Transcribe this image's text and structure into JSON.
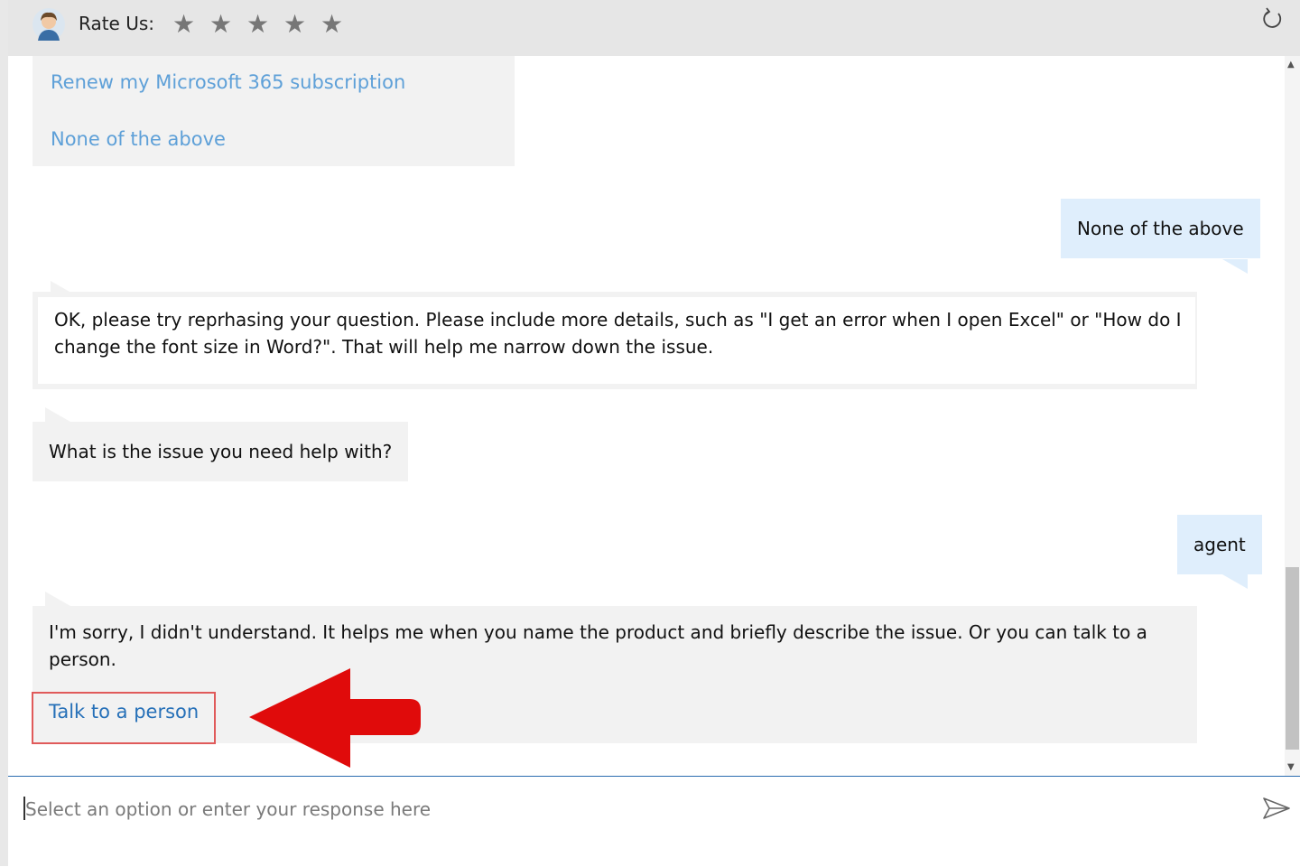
{
  "header": {
    "rate_label": "Rate Us:",
    "stars": [
      "★",
      "★",
      "★",
      "★",
      "★"
    ]
  },
  "messages": {
    "options": [
      "Renew my Microsoft 365 subscription",
      "None of the above"
    ],
    "user_reply_1": "None of the above",
    "bot_rephrase": "OK, please try reprhasing your question. Please include more details, such as \"I get an error when I open Excel\" or \"How do I change the font size in Word?\". That will help me narrow down the issue.",
    "bot_question": "What is the issue you need help with?",
    "user_reply_2": "agent",
    "bot_sorry": "I'm sorry, I didn't understand. It helps me when you name the product and briefly describe the issue. Or you can talk to a person.",
    "talk_link": "Talk to a person"
  },
  "input": {
    "placeholder": "Select an option or enter your response here"
  },
  "colors": {
    "header_bg": "#e6e6e6",
    "bot_bubble": "#f2f2f2",
    "user_bubble": "#dfeefc",
    "link": "#2670b8",
    "annotation_red": "#e00b0b"
  }
}
